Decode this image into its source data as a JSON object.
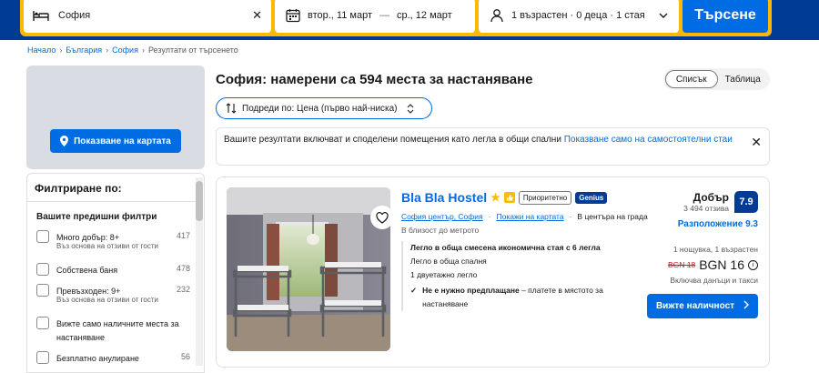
{
  "search": {
    "destination": "София",
    "date_from": "втор., 11 март",
    "date_sep": "—",
    "date_to": "ср., 12 март",
    "occupancy": "1 възрастен · 0 деца · 1 стая",
    "search_button": "Търсене"
  },
  "breadcrumb": [
    "Начало",
    "България",
    "София",
    "Резултати от търсенето"
  ],
  "map": {
    "button": "Показване на картата"
  },
  "filters": {
    "title": "Филтриране по:",
    "section": "Вашите предишни филтри",
    "items": [
      {
        "label": "Много добър: 8+",
        "count": "417",
        "hint": "Въз основа на отзиви от гости"
      },
      {
        "label": "Собствена баня",
        "count": "478",
        "hint": ""
      },
      {
        "label": "Превъзходен: 9+",
        "count": "232",
        "hint": "Въз основа на отзиви от гости"
      },
      {
        "label": "Вижте само наличните места за настаняване",
        "count": "",
        "hint": ""
      },
      {
        "label": "Безплатно анулиране",
        "count": "56",
        "hint": ""
      }
    ]
  },
  "results": {
    "heading": "София: намерени са 594 места за настаняване",
    "view_list": "Списък",
    "view_table": "Таблица",
    "sort": "Подреди по: Цена (първо най-ниска)",
    "notice_text": "Вашите резултати включват и споделени помещения като легла в общи спални ",
    "notice_link": "Показване само на самостоятелни стаи"
  },
  "property": {
    "name": "Bla Bla Hostel",
    "badge_priority": "Приоритетно",
    "badge_genius": "Genius",
    "location": "София център, София",
    "show_map": "Покажи на картата",
    "center": "В центъра на града",
    "metro": "В близост до метрото",
    "room_title": "Легло в обща смесена икономична стая с 6 легла",
    "room_line1": "Легло в обща спалня",
    "room_line2": "1 двуетажно легло",
    "prepay_bold": "Не е нужно предплащане",
    "prepay_rest": " – платете в мястото за настаняване",
    "score_word": "Добър",
    "reviews": "3 494 отзива",
    "score": "7.9",
    "location_score": "Разположение 9.3",
    "nights": "1 нощувка, 1 възрастен",
    "old_price": "BGN 18",
    "new_price": "BGN 16",
    "taxes": "Включва данъци и такси",
    "avail_button": "Вижте наличност"
  },
  "colors": {
    "brand_blue": "#003b95",
    "action_blue": "#006ce4",
    "search_yellow": "#ffb700",
    "price_red": "#d4111e"
  }
}
